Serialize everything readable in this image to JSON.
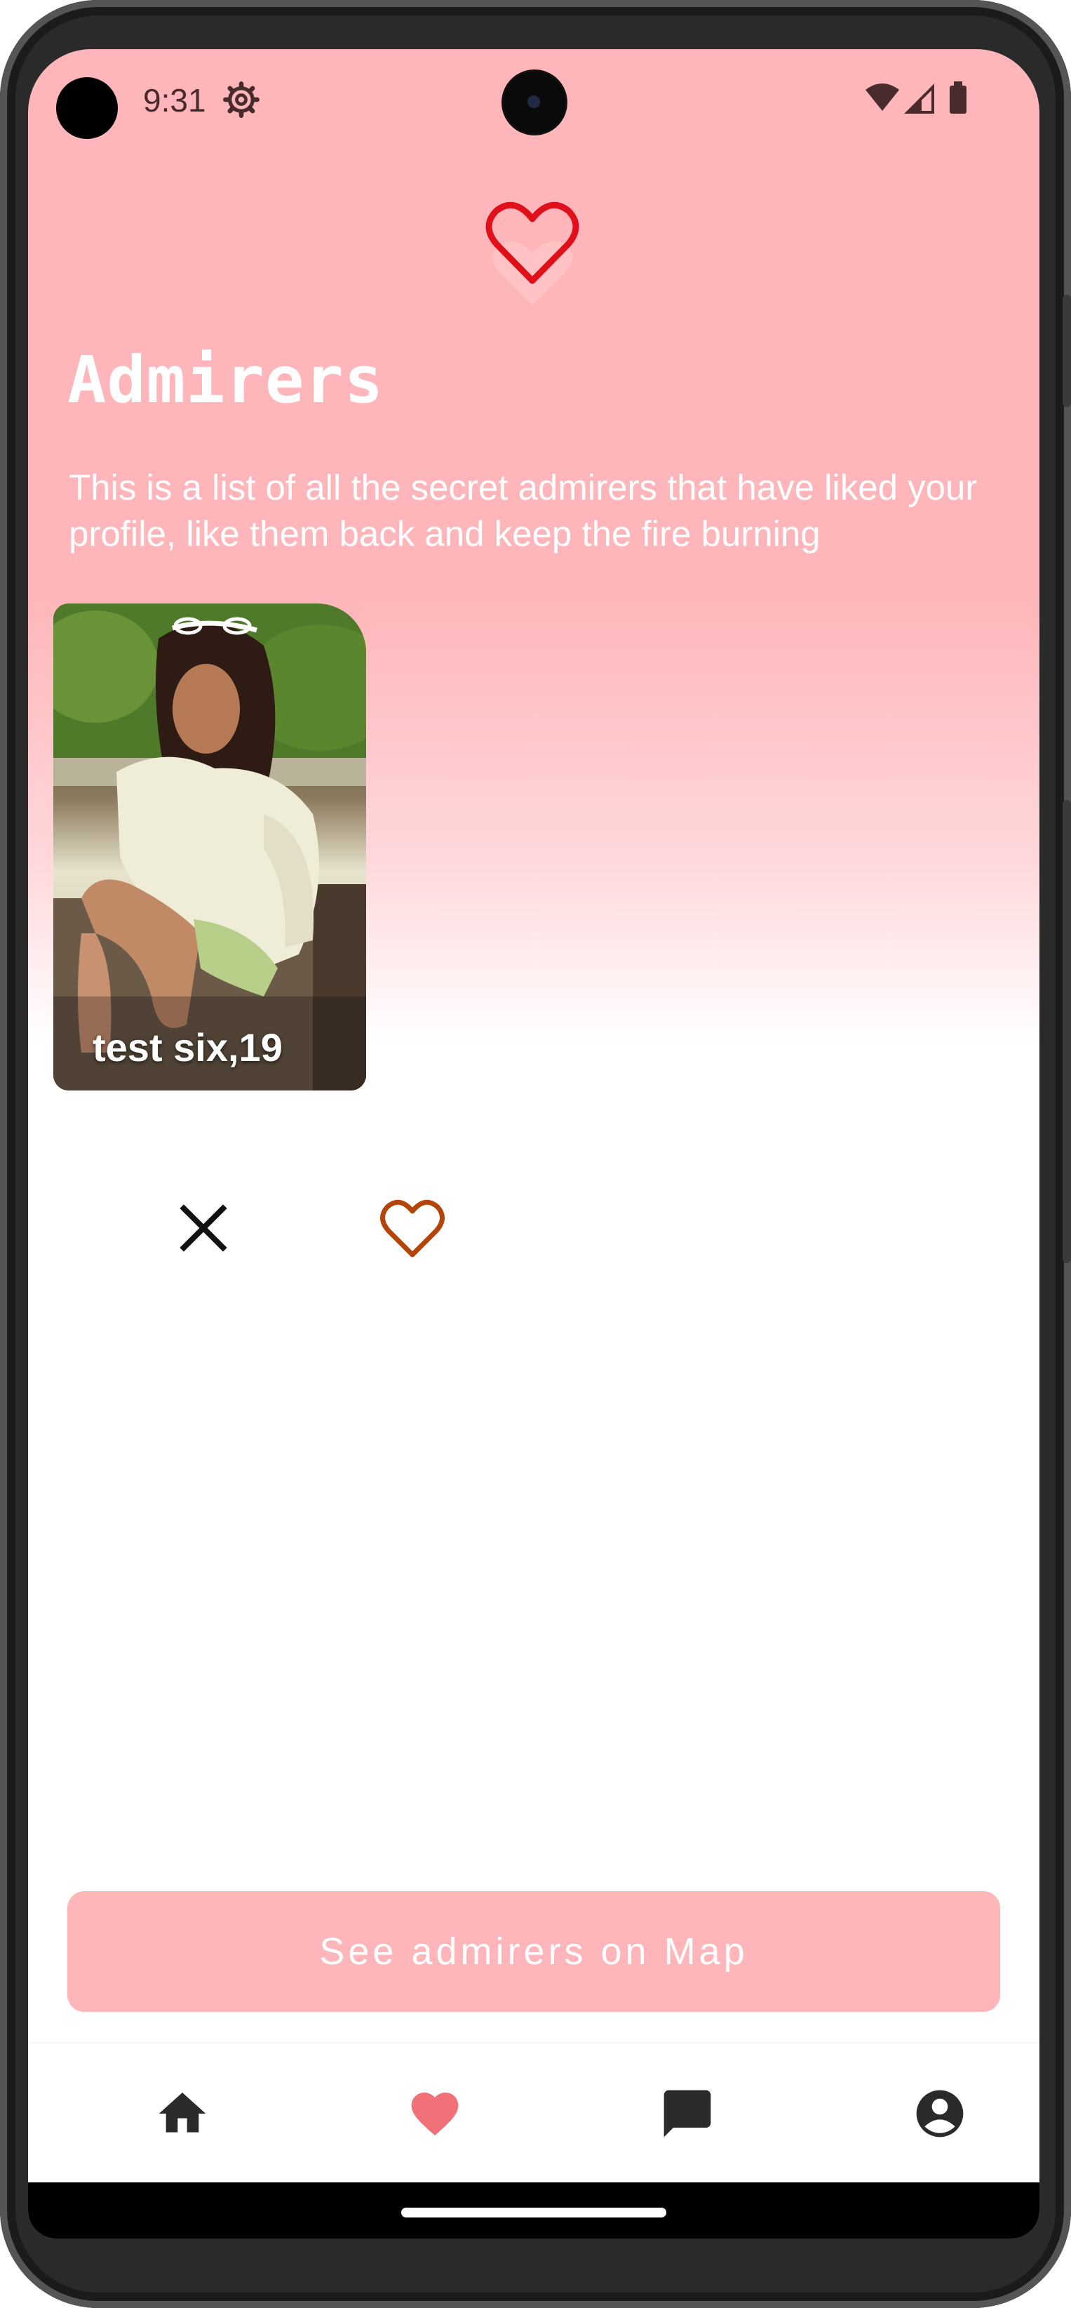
{
  "status_bar": {
    "time": "9:31",
    "icons": [
      "settings-icon",
      "wifi-icon",
      "signal-icon",
      "battery-icon"
    ]
  },
  "header": {
    "logo_icon": "heart-logo-icon",
    "title": "Admirers",
    "subtitle": "This is a list of all the secret admirers that have liked your profile, like them back and keep the fire burning"
  },
  "admirers": [
    {
      "name_age": "test six,19"
    }
  ],
  "actions": {
    "reject_icon": "close-icon",
    "like_icon": "heart-outline-icon"
  },
  "map_button": {
    "label": "See admirers on Map"
  },
  "bottom_nav": {
    "items": [
      "home-icon",
      "heart-icon",
      "chat-icon",
      "account-icon"
    ],
    "active": "heart-icon"
  },
  "colors": {
    "header_pink": "#feb6ba",
    "logo_red": "#e0101a",
    "like_orange": "#b3450b",
    "nav_active": "#f07278",
    "nav_inactive": "#2a2a2a"
  }
}
